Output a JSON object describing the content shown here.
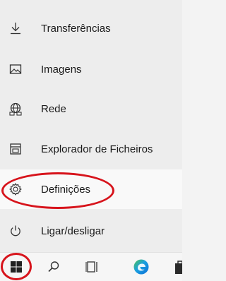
{
  "start_menu": {
    "items": [
      {
        "label": "Transferências",
        "icon": "download-icon"
      },
      {
        "label": "Imagens",
        "icon": "image-icon"
      },
      {
        "label": "Rede",
        "icon": "network-icon"
      },
      {
        "label": "Explorador de Ficheiros",
        "icon": "file-explorer-icon"
      },
      {
        "label": "Definições",
        "icon": "gear-icon"
      },
      {
        "label": "Ligar/desligar",
        "icon": "power-icon"
      }
    ]
  },
  "taskbar": {
    "icons": [
      "windows-start-icon",
      "search-icon",
      "task-view-icon",
      "edge-icon",
      "store-icon"
    ]
  },
  "colors": {
    "annotation": "#d7141c",
    "menu_background": "#ededed",
    "hover_background": "#f9f9f9",
    "edge_blue": "#0c6ed6",
    "edge_green": "#4fc24e"
  }
}
